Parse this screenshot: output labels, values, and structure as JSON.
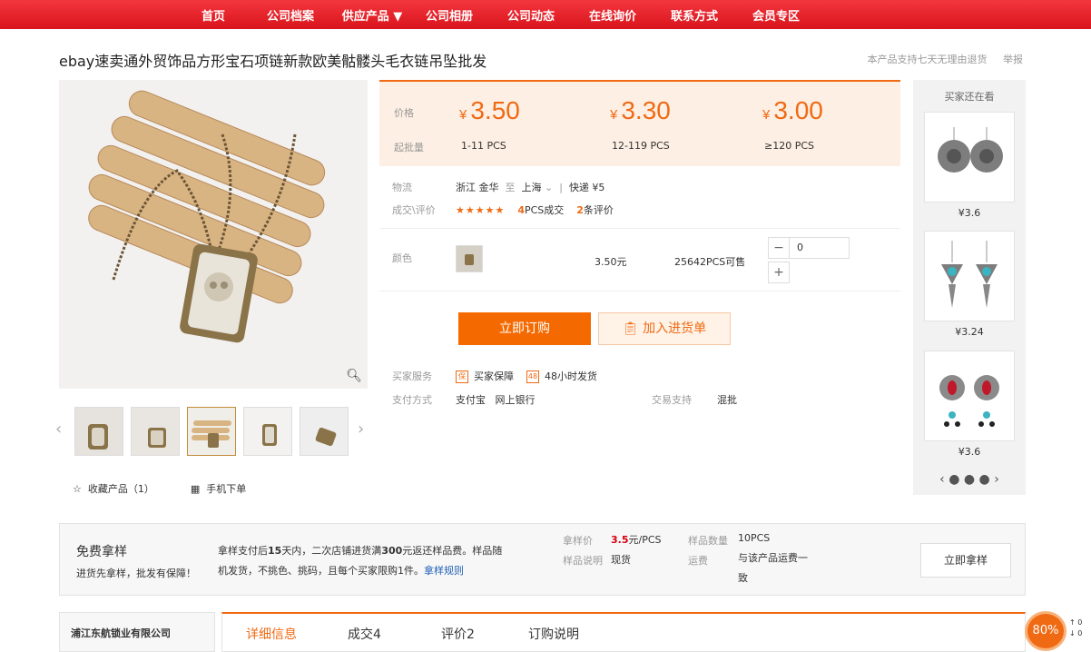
{
  "nav": [
    "首页",
    "公司档案",
    "供应产品 ▼",
    "公司相册",
    "公司动态",
    "在线询价",
    "联系方式",
    "会员专区"
  ],
  "title": "ebay速卖通外贸饰品方形宝石项链新款欧美骷髅头毛衣链吊坠批发",
  "toplinks": {
    "support": "本产品支持七天无理由退货",
    "report": "举报"
  },
  "price": {
    "label": "价格",
    "moq_label": "起批量",
    "currency": "¥",
    "tiers": [
      {
        "price": "3.50",
        "qty": "1-11 PCS"
      },
      {
        "price": "3.30",
        "qty": "12-119 PCS"
      },
      {
        "price": "3.00",
        "qty": "≥120 PCS"
      }
    ]
  },
  "logistics": {
    "label": "物流",
    "from": "浙江 金华",
    "to_word": "至",
    "to": "上海",
    "express": "快递 ¥5"
  },
  "deal": {
    "label": "成交\\评价",
    "stars": "★★★★★",
    "count": "4",
    "count_suffix": "PCS成交",
    "reviews": "2",
    "reviews_suffix": "条评价"
  },
  "color": {
    "label": "颜色",
    "price": "3.50元",
    "stock": "25642PCS可售",
    "qty": "0",
    "minus": "−",
    "plus": "+"
  },
  "buttons": {
    "order": "立即订购",
    "cart": "加入进货单"
  },
  "service": {
    "label": "买家服务",
    "guarantee": "买家保障",
    "ship": "48小时发货",
    "g_icon": "保",
    "s_icon": "48"
  },
  "payment": {
    "label": "支付方式",
    "methods": "支付宝   网上银行",
    "trade_label": "交易支持",
    "trade": "混批"
  },
  "fav": {
    "collect": "收藏产品（1）",
    "mobile": "手机下单"
  },
  "side": {
    "header": "买家还在看",
    "prices": [
      "¥3.6",
      "¥3.24",
      "¥3.6"
    ],
    "dots": "‹  ● ● ●  ›"
  },
  "sample": {
    "title": "免费拿样",
    "subtitle": "进货先拿样，批发有保障！",
    "desc_a": "拿样支付后",
    "desc_days": "15",
    "desc_b": "天内，二次店铺进货满",
    "desc_amt": "300",
    "desc_c": "元返还样品费。样品随机发货，不挑色、挑码，且每个买家限购1件。",
    "desc_link": "拿样规则",
    "price_label": "拿样价",
    "price": "3.5",
    "price_unit": "元/PCS",
    "qty_label": "样品数量",
    "qty": "10PCS",
    "note_label": "样品说明",
    "note": "现货",
    "ship_label": "运费",
    "ship": "与该产品运费一致",
    "button": "立即拿样"
  },
  "company": "浦江东航锁业有限公司",
  "tabs": [
    "详细信息",
    "成交4",
    "评价2",
    "订购说明"
  ],
  "badge": "80%",
  "net": {
    "up": "↑ 0",
    "down": "↓ 0"
  }
}
